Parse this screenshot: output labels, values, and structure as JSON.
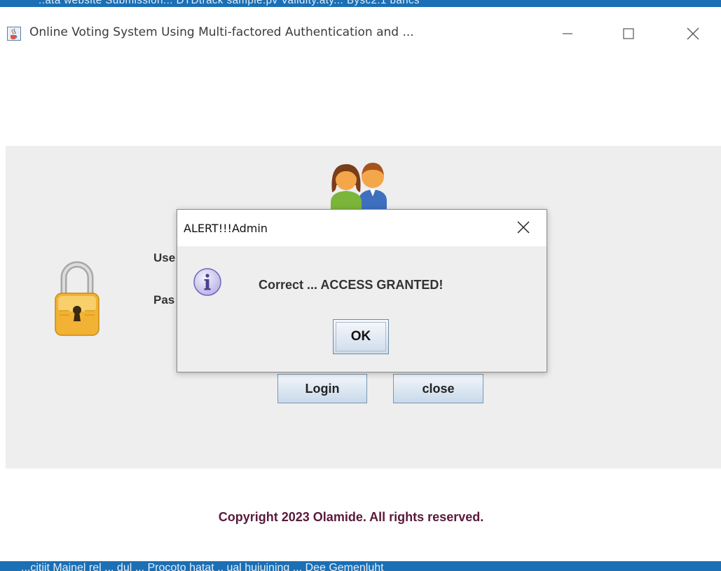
{
  "background": {
    "top_strip_text": "..ata website   Submission...   DTDtrack   sample.pv   Validity.aty...   Bysc2.1   bancs",
    "bottom_strip_text": "...citiit  Mainel  rel  ...  dul  ...   Procoto  hatat ..  ual  huiuining  ...  Dee  Gemenluht",
    "strip_color": "#1a6fb5"
  },
  "window": {
    "title": "Online Voting System Using Multi-factored Authentication and ...",
    "app_icon": "java-cup-icon",
    "controls": {
      "minimize_icon": "minimize-icon",
      "maximize_icon": "maximize-icon",
      "close_icon": "close-icon"
    }
  },
  "login_form": {
    "header_icon": "users-icon",
    "side_icon": "padlock-icon",
    "username_label": "Use",
    "password_label": "Pas",
    "login_button": "Login",
    "close_button": "close"
  },
  "footer": {
    "copyright": "Copyright 2023 Olamide. All rights reserved.",
    "copyright_color": "#5a1a3a"
  },
  "dialog": {
    "title": "ALERT!!!Admin",
    "close_icon": "close-icon",
    "message_icon": "info-icon",
    "message": "Correct ... ACCESS GRANTED!",
    "ok_button": "OK"
  }
}
